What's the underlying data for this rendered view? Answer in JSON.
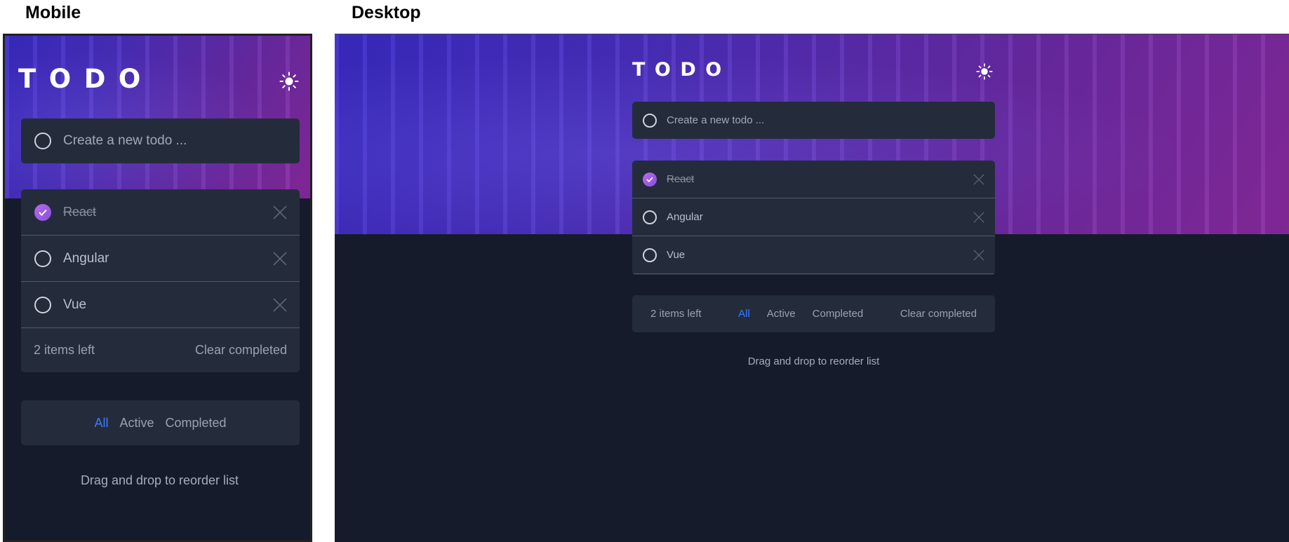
{
  "captions": {
    "mobile": "Mobile",
    "desktop": "Desktop"
  },
  "app": {
    "title": "TODO",
    "theme_icon": "sun-icon",
    "new_todo_placeholder": "Create a new todo ...",
    "todos": [
      {
        "label": "React",
        "completed": true
      },
      {
        "label": "Angular",
        "completed": false
      },
      {
        "label": "Vue",
        "completed": false
      }
    ],
    "items_left": "2 items left",
    "filters": {
      "all": "All",
      "active": "Active",
      "completed": "Completed"
    },
    "active_filter": "All",
    "clear_completed": "Clear completed",
    "hint": "Drag and drop to reorder list"
  },
  "colors": {
    "background": "#151b2a",
    "card": "#242c3b",
    "accent": "#3a7bfd",
    "check_gradient_start": "#b86ae8",
    "check_gradient_end": "#8a4fe0"
  }
}
